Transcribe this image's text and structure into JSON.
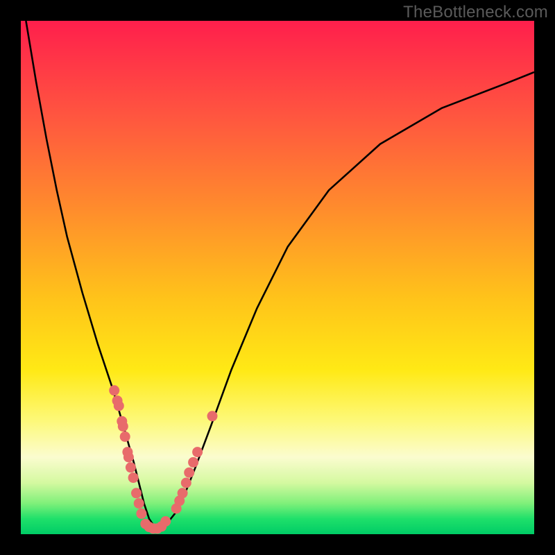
{
  "watermark": "TheBottleneck.com",
  "chart_data": {
    "type": "line",
    "title": "",
    "xlabel": "",
    "ylabel": "",
    "xlim": [
      0,
      100
    ],
    "ylim": [
      0,
      100
    ],
    "series": [
      {
        "name": "bottleneck-curve",
        "x": [
          1,
          3,
          5,
          7,
          9,
          12,
          15,
          18,
          20,
          22,
          23,
          24,
          25,
          26,
          27,
          28,
          30,
          32,
          34,
          37,
          41,
          46,
          52,
          60,
          70,
          82,
          95,
          100
        ],
        "values": [
          100,
          88,
          77,
          67,
          58,
          47,
          37,
          28,
          21,
          14,
          10,
          6,
          3,
          1.5,
          1,
          1.5,
          4,
          8,
          13,
          21,
          32,
          44,
          56,
          67,
          76,
          83,
          88,
          90
        ]
      }
    ],
    "marker_series": [
      {
        "name": "left-cluster",
        "color": "#e86b6b",
        "x": [
          18.2,
          18.8,
          19.1,
          19.7,
          19.9,
          20.3,
          20.8,
          21.0,
          21.4,
          21.9,
          22.5,
          23.0,
          23.5
        ],
        "values": [
          28,
          26,
          25,
          22,
          21,
          19,
          16,
          15,
          13,
          11,
          8,
          6,
          4
        ]
      },
      {
        "name": "bottom-cluster",
        "color": "#e86b6b",
        "x": [
          24.3,
          25.0,
          25.8,
          26.6,
          27.4,
          28.2
        ],
        "values": [
          2,
          1.4,
          1.1,
          1.1,
          1.5,
          2.5
        ]
      },
      {
        "name": "right-cluster",
        "color": "#e86b6b",
        "x": [
          30.3,
          30.9,
          31.5,
          32.2,
          32.8,
          33.6,
          34.4,
          37.3
        ],
        "values": [
          5,
          6.5,
          8,
          10,
          12,
          14,
          16,
          23
        ]
      }
    ]
  }
}
